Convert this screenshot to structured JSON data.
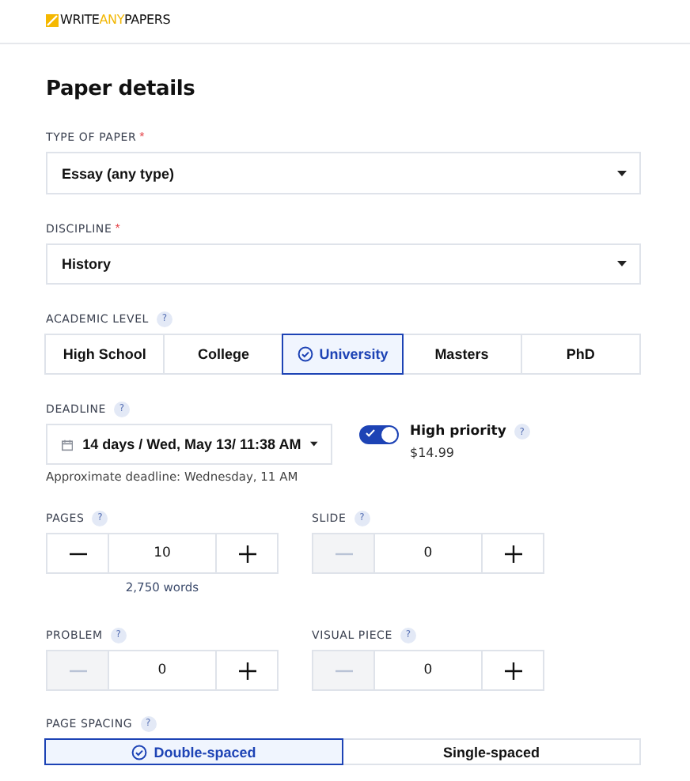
{
  "header": {
    "logo": [
      {
        "text": "WRITE",
        "accent": false
      },
      {
        "text": "ANY",
        "accent": true
      },
      {
        "text": "PAPERS",
        "accent": false
      }
    ]
  },
  "title": "Paper details",
  "type_of_paper": {
    "label": "TYPE OF PAPER",
    "required_mark": "*",
    "value": "Essay (any type)"
  },
  "discipline": {
    "label": "DISCIPLINE",
    "required_mark": "*",
    "value": "History"
  },
  "academic_level": {
    "label": "ACADEMIC LEVEL",
    "help": "?",
    "options": [
      {
        "label": "High School",
        "selected": false
      },
      {
        "label": "College",
        "selected": false
      },
      {
        "label": "University",
        "selected": true
      },
      {
        "label": "Masters",
        "selected": false
      },
      {
        "label": "PhD",
        "selected": false
      }
    ]
  },
  "deadline": {
    "label": "DEADLINE",
    "help": "?",
    "value": "14 days / Wed, May 13/ 11:38 AM",
    "note": "Approximate deadline: Wednesday, 11 AM",
    "high_priority": {
      "label": "High priority",
      "help": "?",
      "on": true,
      "price": "$14.99"
    }
  },
  "counters": [
    {
      "label": "PAGES",
      "help": "?",
      "value": "10",
      "minus_disabled": false,
      "note": "2,750 words"
    },
    {
      "label": "SLIDE",
      "help": "?",
      "value": "0",
      "minus_disabled": true
    },
    {
      "label": "PROBLEM",
      "help": "?",
      "value": "0",
      "minus_disabled": true
    },
    {
      "label": "VISUAL PIECE",
      "help": "?",
      "value": "0",
      "minus_disabled": true
    }
  ],
  "page_spacing": {
    "label": "PAGE SPACING",
    "help": "?",
    "options": [
      {
        "label": "Double-spaced",
        "selected": true
      },
      {
        "label": "Single-spaced",
        "selected": false
      }
    ]
  }
}
